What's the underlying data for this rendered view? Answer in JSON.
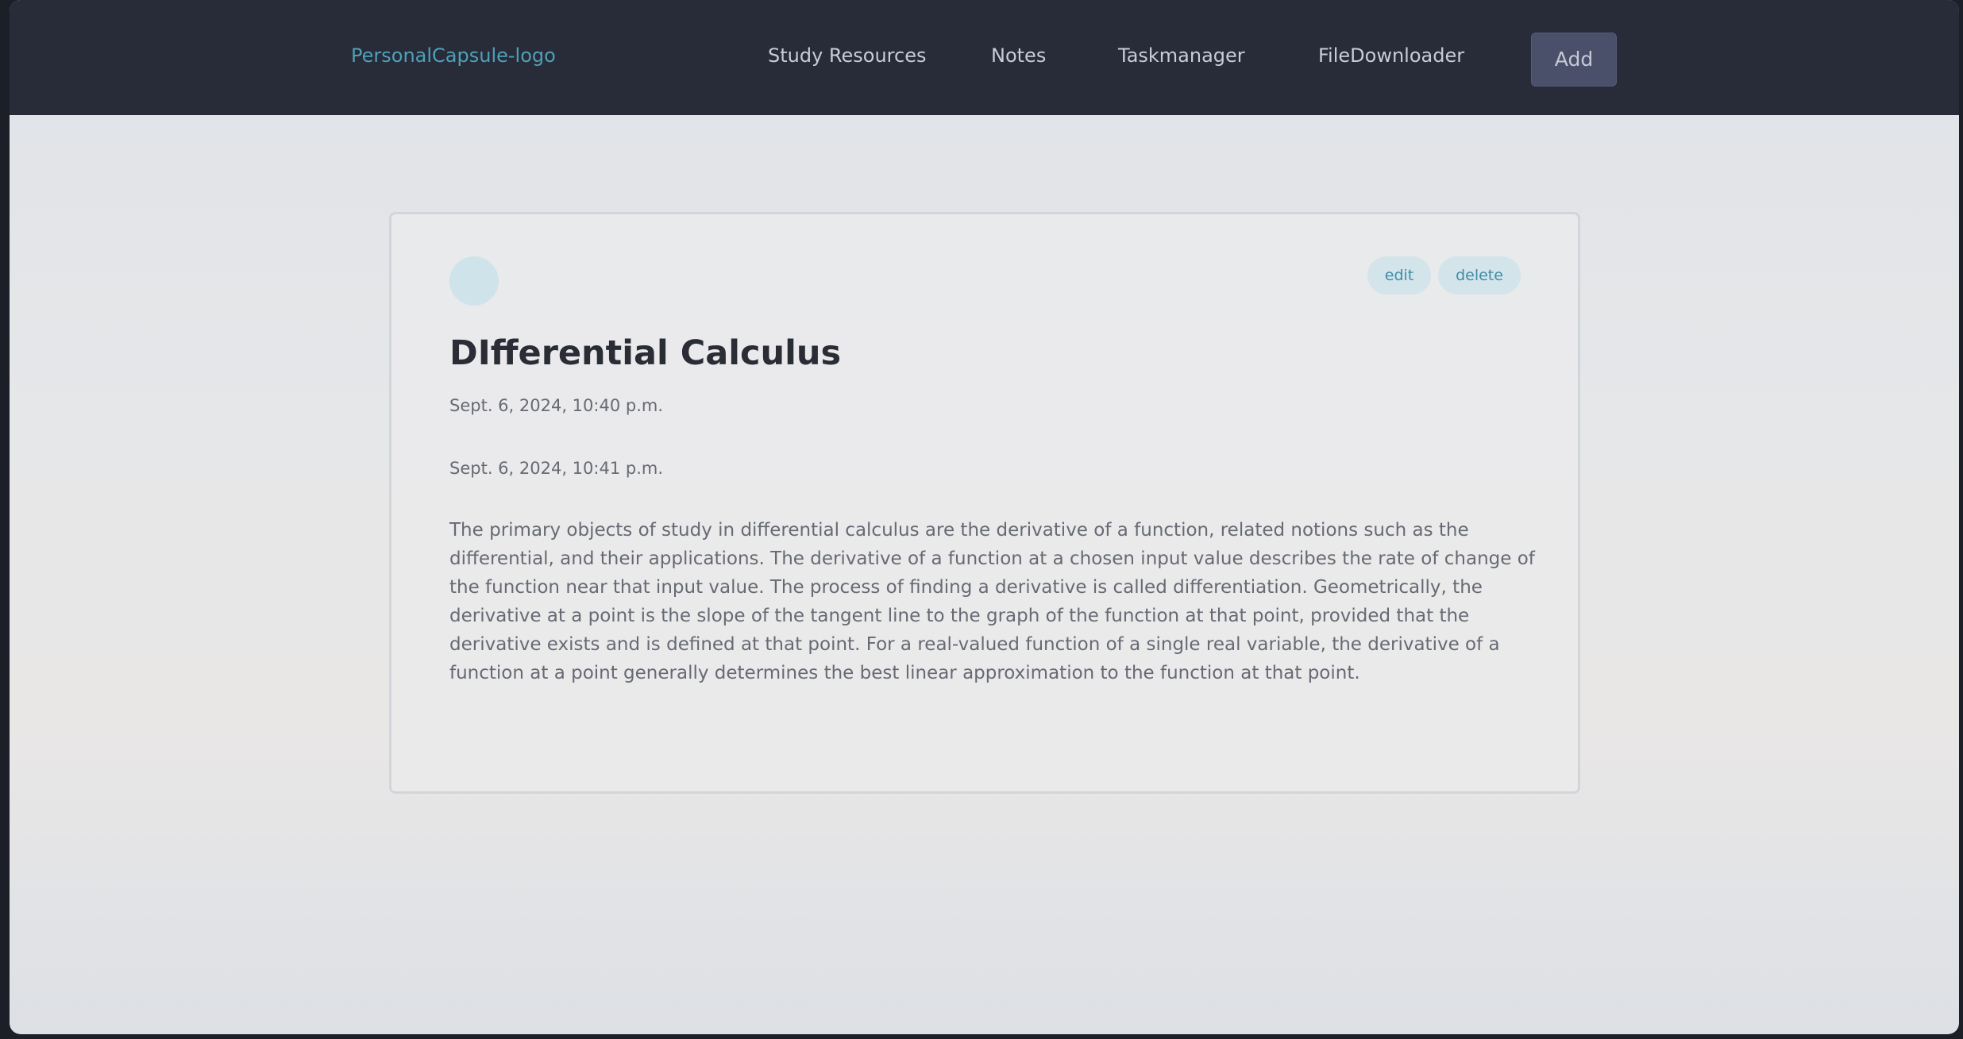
{
  "header": {
    "logo_text": "PersonalCapsule-logo",
    "nav": {
      "study_resources": "Study Resources",
      "notes": "Notes",
      "taskmanager": "Taskmanager",
      "filedownloader": "FileDownloader"
    },
    "add_label": "Add"
  },
  "note": {
    "edit_label": "edit",
    "delete_label": "delete",
    "title": "DIfferential Calculus",
    "created": "Sept. 6, 2024, 10:40 p.m.",
    "updated": "Sept. 6, 2024, 10:41 p.m.",
    "body": "The primary objects of study in differential calculus are the derivative of a function, related notions such as the differential, and their applications. The derivative of a function at a chosen input value describes the rate of change of the function near that input value. The process of finding a derivative is called differentiation. Geometrically, the derivative at a point is the slope of the tangent line to the graph of the function at that point, provided that the derivative exists and is defined at that point. For a real-valued function of a single real variable, the derivative of a function at a point generally determines the best linear approximation to the function at that point."
  },
  "colors": {
    "topbar": "#282b38",
    "logo": "#4fa0b8",
    "add_button": "#4a4f6a",
    "pill_bg": "#d3e4ea",
    "pill_text": "#3f8ea9"
  }
}
